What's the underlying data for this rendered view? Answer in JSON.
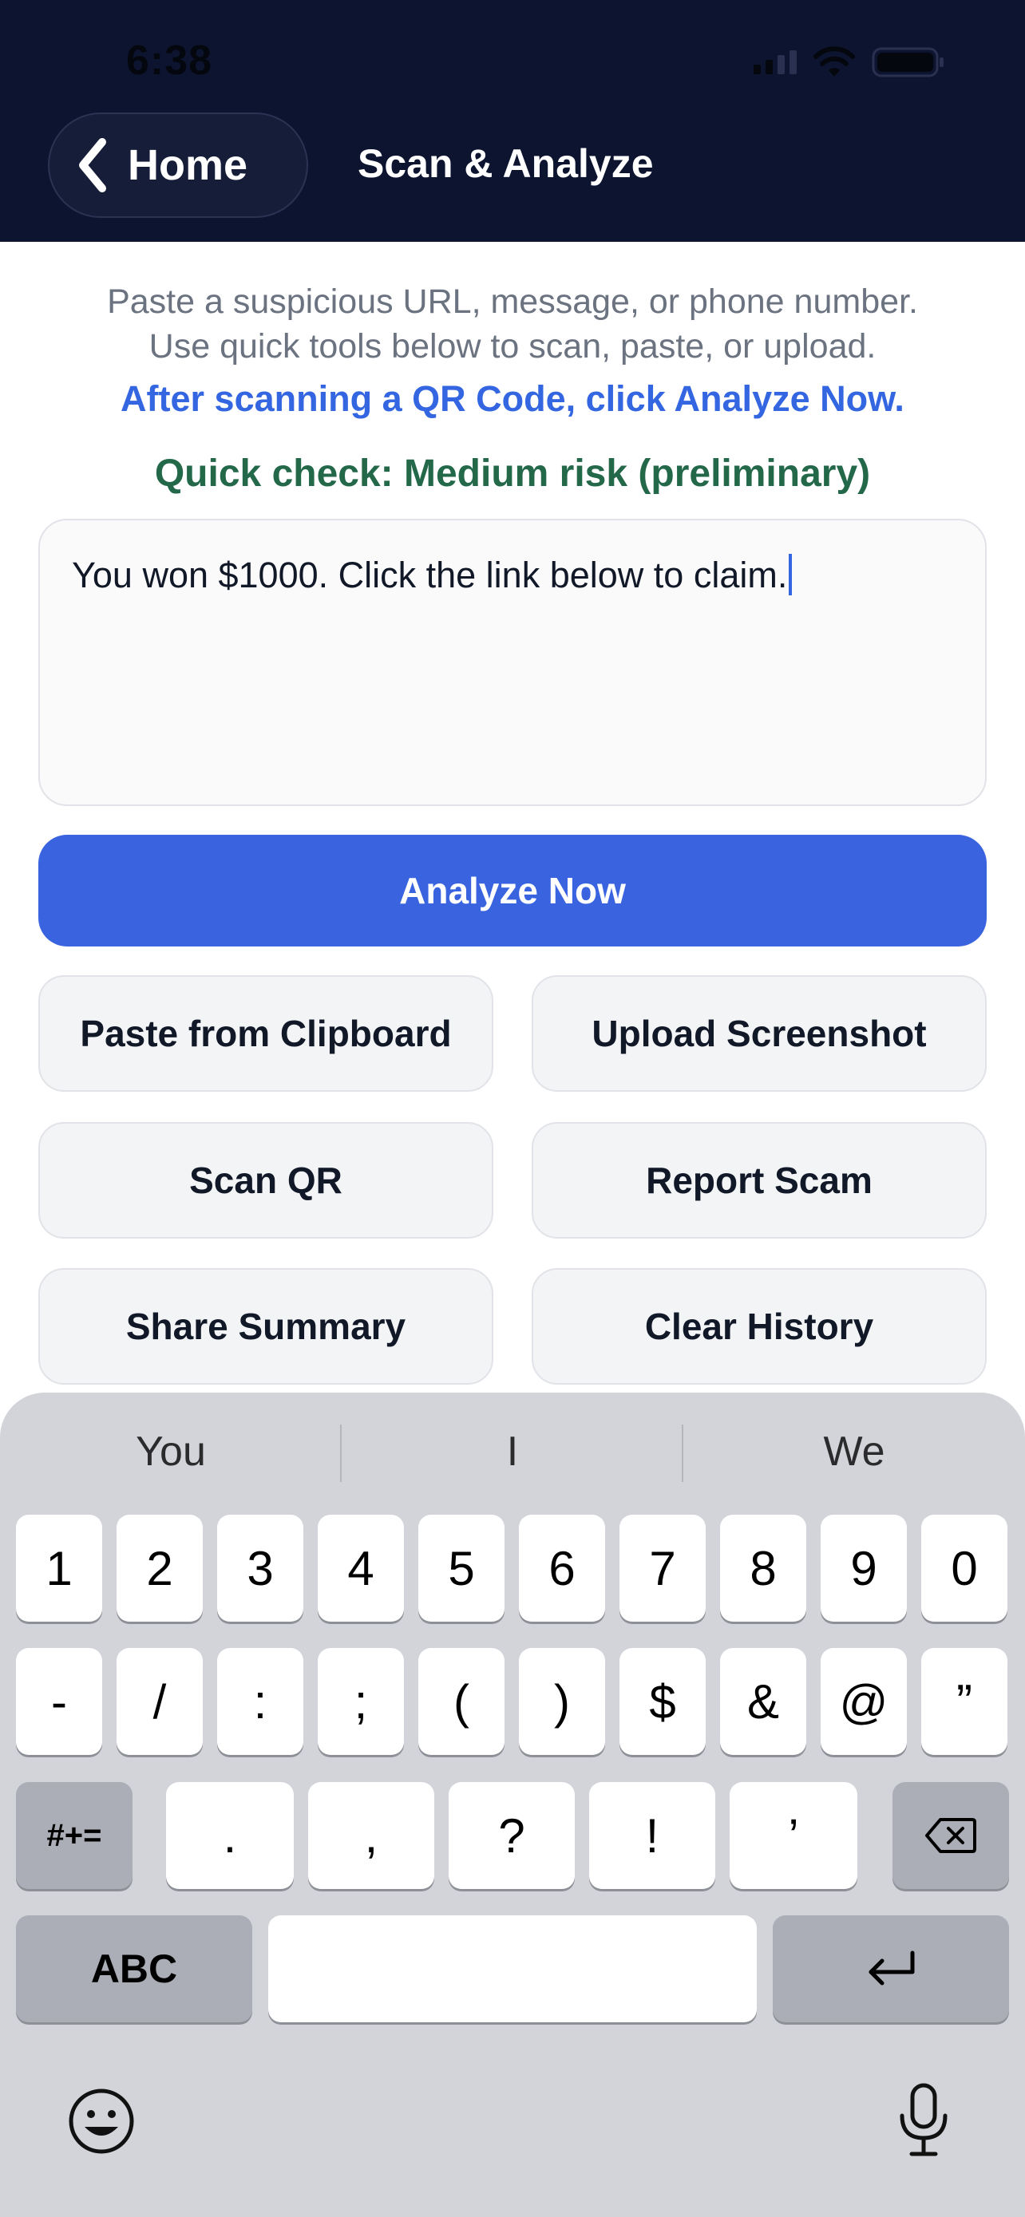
{
  "status_bar": {
    "time": "6:38"
  },
  "header": {
    "back_label": "Home",
    "title": "Scan & Analyze"
  },
  "intro": {
    "line1": "Paste a suspicious URL, message, or phone number.",
    "line2": "Use quick tools below to scan, paste, or upload.",
    "qr_hint": "After scanning a QR Code, click Analyze Now.",
    "quick_check": "Quick check: Medium risk (preliminary)"
  },
  "input": {
    "value": "You won $1000. Click the link below to claim."
  },
  "actions": {
    "analyze": "Analyze Now",
    "paste": "Paste from Clipboard",
    "upload": "Upload Screenshot",
    "scan_qr": "Scan QR",
    "report": "Report Scam",
    "share": "Share Summary",
    "clear": "Clear History"
  },
  "colors": {
    "header_bg": "#0d1430",
    "accent": "#3a63e0",
    "risk_medium": "#24684a"
  },
  "keyboard": {
    "suggestions": [
      "You",
      "I",
      "We"
    ],
    "row1": [
      "1",
      "2",
      "3",
      "4",
      "5",
      "6",
      "7",
      "8",
      "9",
      "0"
    ],
    "row2": [
      "-",
      "/",
      ":",
      ";",
      "(",
      ")",
      "$",
      "&",
      "@",
      "”"
    ],
    "shift_label": "#+=",
    "row3": [
      ".",
      ",",
      "?",
      "!",
      "’"
    ],
    "abc_label": "ABC",
    "icons": {
      "delete": "backspace-icon",
      "return": "return-icon",
      "emoji": "emoji-icon",
      "dictation": "microphone-icon"
    }
  }
}
